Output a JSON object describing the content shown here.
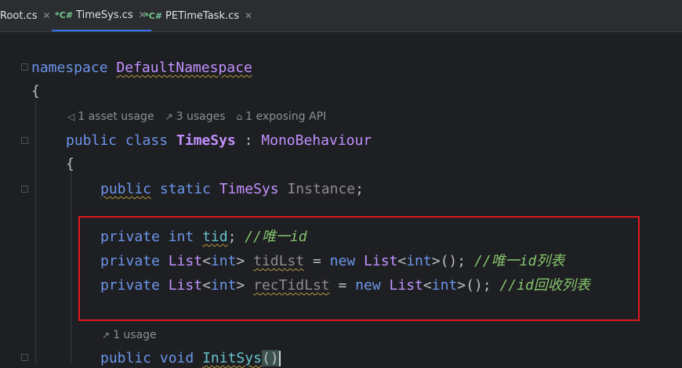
{
  "tabs": [
    {
      "name": "Root.cs",
      "prefix": "",
      "close": "✕",
      "active": false
    },
    {
      "name": "TimeSys.cs",
      "prefix": "*C#",
      "close": "✕",
      "active": true
    },
    {
      "name": "PETimeTask.cs",
      "prefix": "*C#",
      "close": "✕",
      "active": false
    }
  ],
  "code": {
    "l1": {
      "kw": "namespace",
      "name": "DefaultNamespace"
    },
    "l2": "{",
    "hints_class": [
      {
        "icon": "unity-icon",
        "text": "1 asset usage"
      },
      {
        "icon": "usage-arrow-icon",
        "text": "3 usages"
      },
      {
        "icon": "api-icon",
        "text": "1 exposing API"
      }
    ],
    "l3": {
      "kw1": "public",
      "kw2": "class",
      "name": "TimeSys",
      "colon": " : ",
      "base": "MonoBehaviour"
    },
    "l4": "{",
    "l5": {
      "kw1": "public",
      "kw2": "static",
      "type": "TimeSys",
      "name": "Instance",
      "end": ";"
    },
    "l6": {
      "kw": "private",
      "type": "int",
      "name": "tid",
      "end": ";",
      "comment": "//唯一id"
    },
    "l7": {
      "kw": "private",
      "type": "List",
      "lt": "<",
      "targ": "int",
      "gt": ">",
      "name": "tidLst",
      "eq": " = ",
      "new": "new",
      "type2": "List",
      "lt2": "<",
      "targ2": "int",
      "gt2": ">",
      "end": "();",
      "comment": "//唯一id列表"
    },
    "l8": {
      "kw": "private",
      "type": "List",
      "lt": "<",
      "targ": "int",
      "gt": ">",
      "name": "recTidLst",
      "eq": " = ",
      "new": "new",
      "type2": "List",
      "lt2": "<",
      "targ2": "int",
      "gt2": ">",
      "end": "();",
      "comment": "//id回收列表"
    },
    "hints_method": [
      {
        "icon": "usage-arrow-icon",
        "text": "1 usage"
      }
    ],
    "l9": {
      "kw1": "public",
      "kw2": "void",
      "name": "InitSys",
      "parens": "()"
    }
  }
}
